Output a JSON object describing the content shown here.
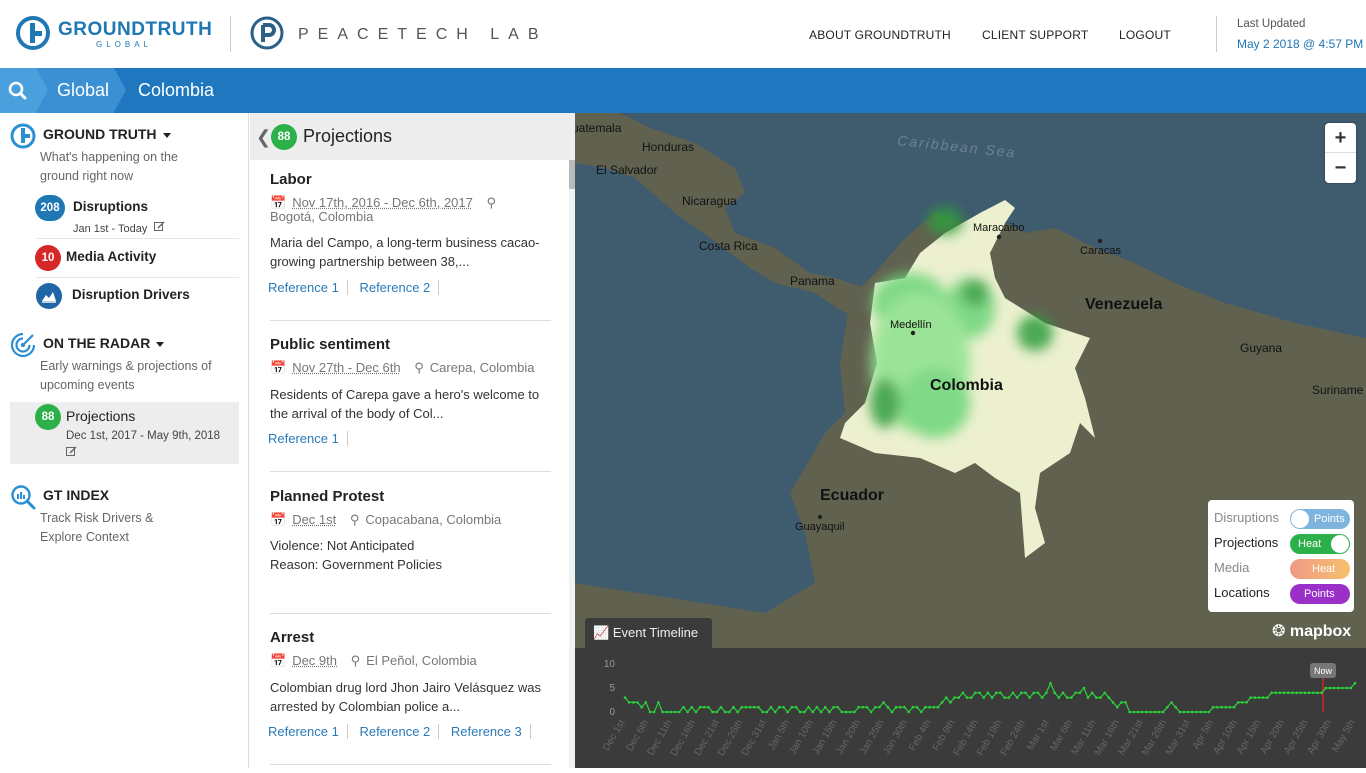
{
  "header": {
    "gt_logo_word": "GROUNDTRUTH",
    "gt_logo_sub": "GLOBAL",
    "peacetech_word": "PEACETECH LAB",
    "nav": [
      "ABOUT GROUNDTRUTH",
      "CLIENT SUPPORT",
      "LOGOUT"
    ],
    "last_updated_label": "Last Updated",
    "last_updated_value": "May 2 2018 @ 4:57 PM"
  },
  "breadcrumb": {
    "items": [
      "Global",
      "Colombia"
    ]
  },
  "sidebar": {
    "ground_truth": {
      "title": "GROUND TRUTH",
      "desc": "What's happening on the ground right now",
      "items": [
        {
          "count": "208",
          "label": "Disruptions",
          "sub": "Jan 1st - Today"
        },
        {
          "count": "10",
          "label": "Media Activity"
        },
        {
          "label": "Disruption Drivers"
        }
      ]
    },
    "on_the_radar": {
      "title": "ON THE RADAR",
      "desc": "Early warnings & projections of upcoming events",
      "items": [
        {
          "count": "88",
          "label": "Projections",
          "sub": "Dec 1st, 2017 - May 9th, 2018"
        }
      ]
    },
    "gt_index": {
      "title": "GT INDEX",
      "desc": "Track Risk Drivers & Explore Context"
    }
  },
  "list": {
    "count": "88",
    "title": "Projections",
    "cards": [
      {
        "title": "Labor",
        "date": "Nov 17th, 2016 - Dec 6th, 2017",
        "location": "Bogotá, Colombia",
        "body": "Maria del Campo, a long-term business cacao-growing partnership between 38,...",
        "refs": [
          "Reference 1",
          "Reference 2"
        ]
      },
      {
        "title": "Public sentiment",
        "date": "Nov 27th - Dec 6th",
        "location": "Carepa, Colombia",
        "body": "Residents of Carepa gave a hero's welcome to the arrival of the body of Col...",
        "refs": [
          "Reference 1"
        ]
      },
      {
        "title": "Planned Protest",
        "date": "Dec 1st",
        "location": "Copacabana, Colombia",
        "body": "Violence: Not Anticipated",
        "body2": "Reason: Government Policies",
        "refs": []
      },
      {
        "title": "Arrest",
        "date": "Dec 9th",
        "location": "El Peñol, Colombia",
        "body": "Colombian drug lord Jhon Jairo Velásquez was arrested by Colombian police a...",
        "refs": [
          "Reference 1",
          "Reference 2",
          "Reference 3"
        ]
      }
    ]
  },
  "map": {
    "labels": {
      "caribbean": "Caribbean Sea",
      "guatemala": "uatemala",
      "honduras": "Honduras",
      "el_salvador": "El Salvador",
      "nicaragua": "Nicaragua",
      "costa_rica": "Costa Rica",
      "panama": "Panama",
      "maracaibo": "Maracaibo",
      "caracas": "Caracas",
      "venezuela": "Venezuela",
      "guyana": "Guyana",
      "suriname": "Suriname",
      "medellin": "Medellín",
      "colombia": "Colombia",
      "ecuador": "Ecuador",
      "guayaquil": "Guayaquil"
    },
    "zoom_in": "+",
    "zoom_out": "−",
    "attribution": "mapbox",
    "legend": [
      {
        "label": "Disruptions",
        "toggle": "Points",
        "active": false,
        "color": "#7fb4de"
      },
      {
        "label": "Projections",
        "toggle": "Heat",
        "active": true,
        "color": "#2bb04a"
      },
      {
        "label": "Media",
        "toggle": "Heat",
        "active": false,
        "color": "#f0a37b"
      },
      {
        "label": "Locations",
        "toggle": "Points",
        "active": true,
        "color": "#9b30c8"
      }
    ]
  },
  "timeline": {
    "tab_label": "Event Timeline",
    "now_label": "Now",
    "chart_data": {
      "type": "line",
      "ylim": [
        0,
        10
      ],
      "yticks": [
        "10",
        "5",
        "0"
      ],
      "xticks": [
        "Dec 1st",
        "Dec 6th",
        "Dec 11th",
        "Dec 16th",
        "Dec 21st",
        "Dec 26th",
        "Dec 31st",
        "Jan 5th",
        "Jan 10th",
        "Jan 15th",
        "Jan 20th",
        "Jan 25th",
        "Jan 30th",
        "Feb 4th",
        "Feb 9th",
        "Feb 14th",
        "Feb 19th",
        "Feb 24th",
        "Mar 1st",
        "Mar 6th",
        "Mar 11th",
        "Mar 16th",
        "Mar 21st",
        "Mar 26th",
        "Mar 31st",
        "Apr 5th",
        "Apr 10th",
        "Apr 15th",
        "Apr 20th",
        "Apr 25th",
        "Apr 30th",
        "May 5th"
      ],
      "series": [
        {
          "color": "#2bd13b",
          "values": [
            3,
            2,
            2,
            2,
            1,
            2,
            0,
            0,
            2,
            0,
            0,
            0,
            0,
            0,
            1,
            0,
            1,
            0,
            1,
            1,
            1,
            0,
            0,
            1,
            0,
            0,
            1,
            0,
            1,
            1,
            1,
            1,
            1,
            0,
            0,
            1,
            0,
            1,
            1,
            0,
            1,
            1,
            0,
            0,
            1,
            0,
            1,
            0,
            1,
            0,
            1,
            1,
            0,
            0,
            0,
            0,
            1,
            1,
            1,
            0,
            1,
            1,
            2,
            1,
            0,
            1,
            1,
            1,
            0,
            1,
            1,
            0,
            1,
            1,
            1,
            1,
            2,
            3,
            2,
            3,
            3,
            4,
            3,
            3,
            4,
            4,
            3,
            4,
            3,
            4,
            4,
            3,
            3,
            4,
            3,
            4,
            4,
            3,
            4,
            4,
            3,
            4,
            6,
            4,
            3,
            4,
            3,
            3,
            4,
            4,
            5,
            3,
            4,
            3,
            3,
            4,
            3,
            2,
            1,
            2,
            2,
            0,
            0,
            0,
            0,
            0,
            0,
            0,
            0,
            0,
            1,
            2,
            1,
            0,
            0,
            0,
            0,
            0,
            0,
            0,
            0,
            1,
            1,
            1,
            1,
            1,
            1,
            2,
            2,
            2,
            3,
            3,
            3,
            3,
            3,
            4,
            4,
            4,
            4,
            4,
            4,
            4,
            4,
            4,
            4,
            4,
            4,
            4,
            5,
            5,
            5,
            5,
            5,
            5,
            5,
            6
          ]
        }
      ]
    }
  }
}
